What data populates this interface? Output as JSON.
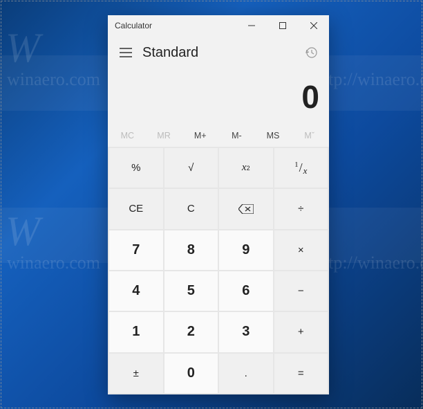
{
  "window": {
    "title": "Calculator"
  },
  "mode": "Standard",
  "display": "0",
  "memory": {
    "mc": "MC",
    "mr": "MR",
    "mplus": "M+",
    "mminus": "M-",
    "ms": "MS",
    "mlist": "Mˇ",
    "mc_enabled": false,
    "mr_enabled": false,
    "mlist_enabled": false
  },
  "keys": {
    "percent": "%",
    "sqrt": "√",
    "ce": "CE",
    "c": "C",
    "divide": "÷",
    "multiply": "×",
    "minus": "−",
    "plus": "+",
    "equals": "=",
    "negate": "±",
    "decimal": ".",
    "n0": "0",
    "n1": "1",
    "n2": "2",
    "n3": "3",
    "n4": "4",
    "n5": "5",
    "n6": "6",
    "n7": "7",
    "n8": "8",
    "n9": "9"
  }
}
